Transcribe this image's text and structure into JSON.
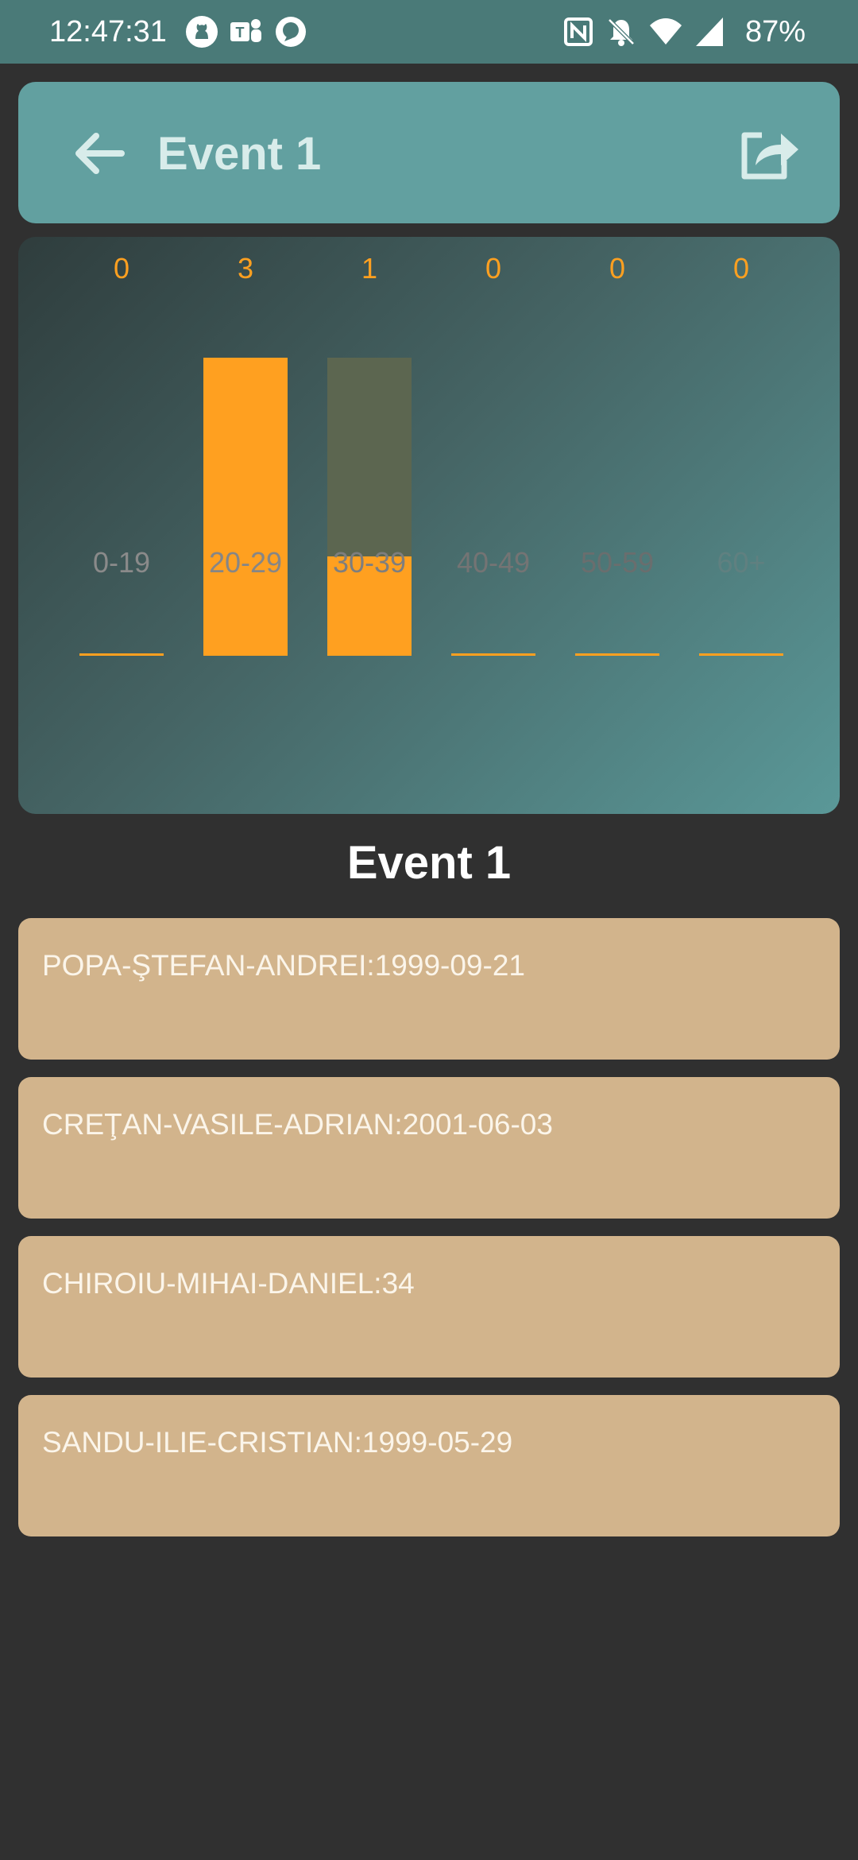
{
  "status_bar": {
    "time": "12:47:31",
    "battery": "87%",
    "left_icons": [
      "github-icon",
      "teams-icon",
      "chat-bubble-icon"
    ],
    "right_icons": [
      "nfc-icon",
      "notifications-off-icon",
      "wifi-icon",
      "cell-signal-icon"
    ]
  },
  "app_bar": {
    "title": "Event 1",
    "back_icon": "arrow-left-icon",
    "share_icon": "share-icon"
  },
  "colors": {
    "bar": "#ffa020",
    "bar_track": "#5c6650",
    "count_label": "#ffa020",
    "app_bar": "#62a0a0",
    "entry_card": "#d2b48c",
    "background": "#303030"
  },
  "chart_data": {
    "type": "bar",
    "categories": [
      "0-19",
      "20-29",
      "30-39",
      "40-49",
      "50-59",
      "60+"
    ],
    "values": [
      0,
      3,
      1,
      0,
      0,
      0
    ],
    "ylim": [
      0,
      3
    ],
    "data_labels": [
      "0",
      "3",
      "1",
      "0",
      "0",
      "0"
    ],
    "grid": false,
    "legend": "none"
  },
  "section_title": "Event 1",
  "entries": [
    {
      "text": "POPA-ŞTEFAN-ANDREI:1999-09-21"
    },
    {
      "text": "CREŢAN-VASILE-ADRIAN:2001-06-03"
    },
    {
      "text": "CHIROIU-MIHAI-DANIEL:34"
    },
    {
      "text": "SANDU-ILIE-CRISTIAN:1999-05-29"
    }
  ]
}
